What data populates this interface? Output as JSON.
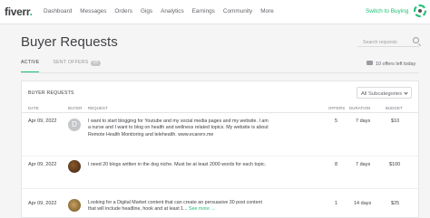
{
  "nav": {
    "logo": "fiverr",
    "logo_dot": ".",
    "items": [
      "Dashboard",
      "Messages",
      "Orders",
      "Gigs",
      "Analytics",
      "Earnings",
      "Community",
      "More"
    ],
    "switch_label": "Switch to Buying"
  },
  "header": {
    "title": "Buyer Requests",
    "search_placeholder": "Search requests"
  },
  "tabs": [
    {
      "label": "ACTIVE",
      "active": true
    },
    {
      "label": "SENT OFFERS",
      "count": "10"
    }
  ],
  "offers_left": "10 offers left today",
  "table": {
    "title": "BUYER REQUESTS",
    "subcategory": "All Subcategories",
    "columns": [
      "DATE",
      "BUYER",
      "REQUEST",
      "OFFERS",
      "DURATION",
      "BUDGET"
    ],
    "rows": [
      {
        "date": "Apr 09, 2022",
        "buyer": "D",
        "request": "I want to start blogging for Youtube and my social media pages and my website. I am a nurse and I want to blog on health and wellness related topics. My website is about Remote Health Monitoring and telehealth. www.ecarerx.me",
        "offers": "5",
        "duration": "7 days",
        "budget": "$10"
      },
      {
        "date": "Apr 09, 2022",
        "buyer": "",
        "request": "I need 20 blogs written in the dog niche. Must be at least 2000 words for each topic.",
        "offers": "8",
        "duration": "7 days",
        "budget": "$100"
      },
      {
        "date": "Apr 09, 2022",
        "buyer": "",
        "request": "Looking for a Digital Market content that can create an persuasive 30 post content that will include headline, hook and at least 1...",
        "see_more": "See more",
        "offers": "1",
        "duration": "14 days",
        "budget": "$25"
      }
    ]
  },
  "colors": {
    "accent": "#1dbf73",
    "text": "#404145",
    "muted": "#74767e"
  }
}
